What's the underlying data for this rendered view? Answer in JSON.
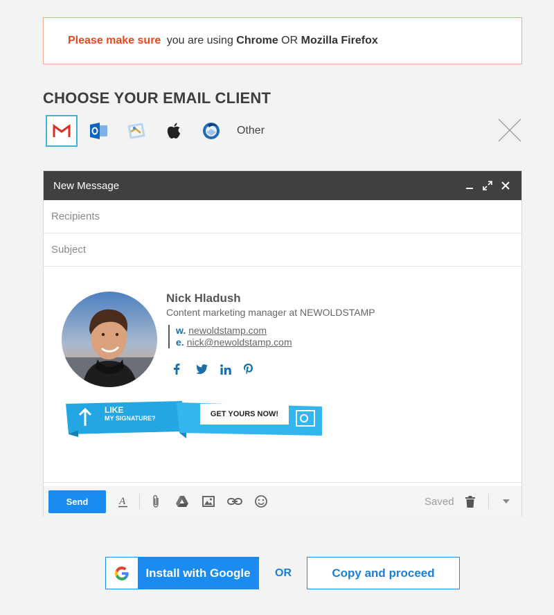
{
  "notice": {
    "warning": "Please make sure",
    "text1": " you are using ",
    "browser1": "Chrome",
    "text2": " OR ",
    "browser2": "Mozilla Firefox"
  },
  "heading": "CHOOSE YOUR EMAIL CLIENT",
  "clients": {
    "items": [
      {
        "icon": "gmail-icon",
        "selected": true
      },
      {
        "icon": "outlook-icon",
        "selected": false
      },
      {
        "icon": "mac-mail-icon",
        "selected": false
      },
      {
        "icon": "apple-icon",
        "selected": false
      },
      {
        "icon": "thunderbird-icon",
        "selected": false
      }
    ],
    "other_label": "Other"
  },
  "composer": {
    "title": "New Message",
    "recipients_placeholder": "Recipients",
    "subject_placeholder": "Subject"
  },
  "signature": {
    "name": "Nick Hladush",
    "title": "Content marketing manager at NEWOLDSTAMP",
    "website_label": "w.",
    "website": "newoldstamp.com",
    "email_label": "e.",
    "email": "nick@newoldstamp.com",
    "socials": [
      "facebook-icon",
      "twitter-icon",
      "linkedin-icon",
      "pinterest-icon"
    ],
    "banner": {
      "line1": "LIKE",
      "line2": "MY SIGNATURE?",
      "cta": "GET YOURS NOW!"
    }
  },
  "toolbar": {
    "send_label": "Send",
    "saved_label": "Saved"
  },
  "actions": {
    "google_label": "Install with Google",
    "or_label": "OR",
    "copy_label": "Copy and proceed"
  },
  "colors": {
    "accent": "#1a8cf1",
    "warning": "#e8481c",
    "selected_border": "#3cb5d8",
    "header_bar": "#404040"
  }
}
